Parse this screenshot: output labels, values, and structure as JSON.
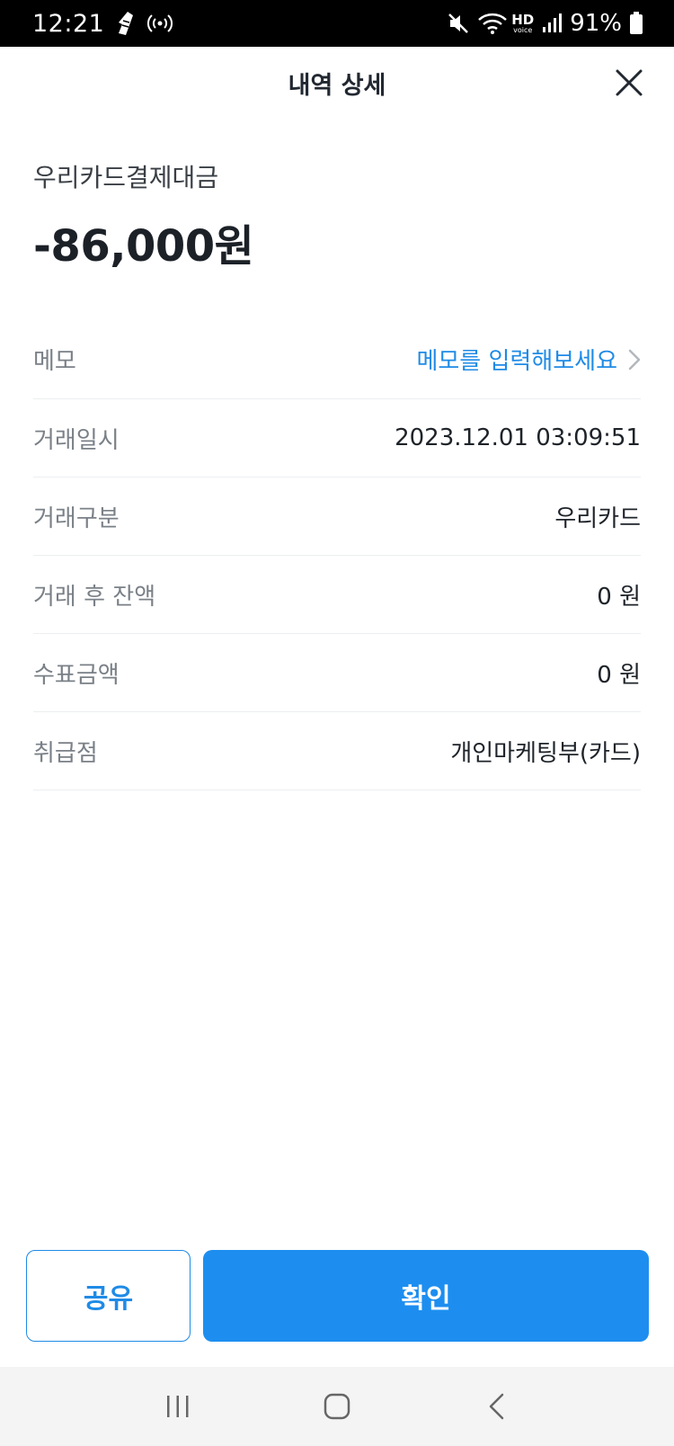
{
  "status_bar": {
    "time": "12:21",
    "battery_percent": "91%",
    "hd_label": "HD",
    "voice_label": "voice"
  },
  "header": {
    "title": "내역 상세"
  },
  "transaction": {
    "merchant": "우리카드결제대금",
    "amount": "-86,000원"
  },
  "details": {
    "memo": {
      "label": "메모",
      "placeholder": "메모를 입력해보세요"
    },
    "datetime": {
      "label": "거래일시",
      "value": "2023.12.01 03:09:51"
    },
    "type": {
      "label": "거래구분",
      "value": "우리카드"
    },
    "balance_after": {
      "label": "거래 후 잔액",
      "value": "0 원"
    },
    "check_amount": {
      "label": "수표금액",
      "value": "0 원"
    },
    "branch": {
      "label": "취급점",
      "value": "개인마케팅부(카드)"
    }
  },
  "buttons": {
    "share": "공유",
    "confirm": "확인"
  },
  "colors": {
    "accent": "#1d8ef0",
    "link": "#1f8be6",
    "text_primary": "#1e2329",
    "text_secondary": "#7a8087"
  }
}
